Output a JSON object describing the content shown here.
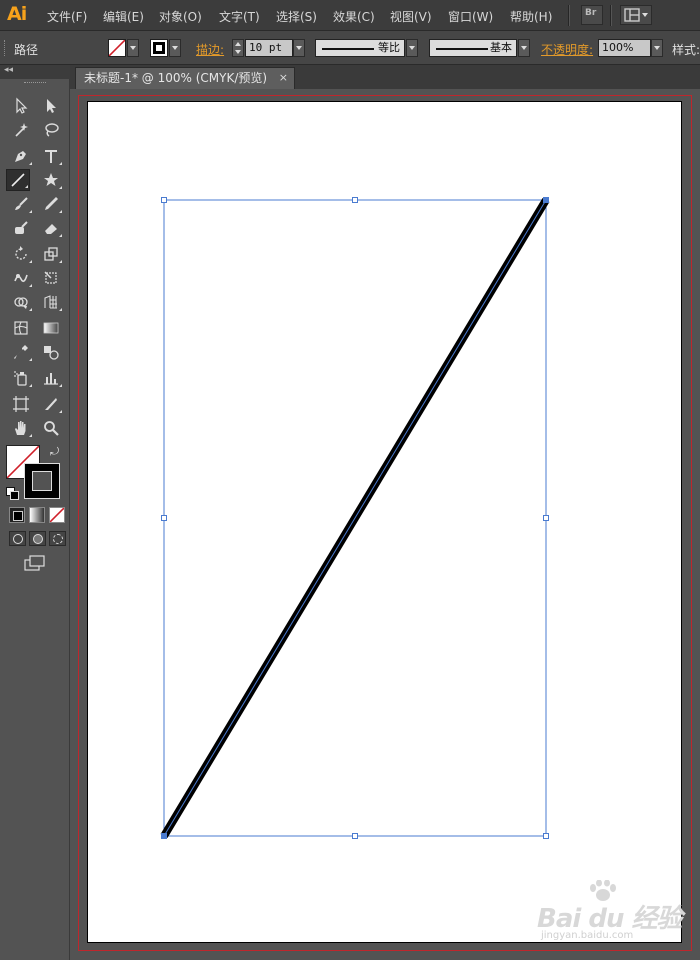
{
  "app": {
    "logo": "Ai"
  },
  "menu": {
    "items": [
      "文件(F)",
      "编辑(E)",
      "对象(O)",
      "文字(T)",
      "选择(S)",
      "效果(C)",
      "视图(V)",
      "窗口(W)",
      "帮助(H)"
    ],
    "bridge_label": "Br"
  },
  "control": {
    "path_label": "路径",
    "stroke_label": "描边:",
    "stroke_weight": "10 pt",
    "profile_label": "等比",
    "brush_label": "基本",
    "opacity_label": "不透明度:",
    "opacity_value": "100%",
    "style_label": "样式:"
  },
  "document": {
    "tab_title": "未标题-1* @ 100% (CMYK/预览)",
    "close_glyph": "×"
  },
  "toolbox": {
    "collapse_glyph": "◂◂",
    "tools": [
      "selection-tool",
      "direct-selection-tool",
      "magic-wand-tool",
      "lasso-tool",
      "pen-tool",
      "type-tool",
      "line-segment-tool",
      "star-tool",
      "paintbrush-tool",
      "pencil-tool",
      "blob-brush-tool",
      "eraser-tool",
      "rotate-tool",
      "scale-tool",
      "warp-tool",
      "free-transform-tool",
      "shape-builder-tool",
      "perspective-grid-tool",
      "mesh-tool",
      "gradient-tool",
      "eyedropper-tool",
      "blend-tool",
      "symbol-sprayer-tool",
      "column-graph-tool",
      "artboard-tool",
      "slice-tool",
      "hand-tool",
      "zoom-tool"
    ],
    "active_tool": "line-segment-tool"
  },
  "colors": {
    "accent": "#f7a21b",
    "selection": "#4a7bd0",
    "bleed": "#c0262c",
    "stroke": "#000000"
  },
  "watermark": {
    "main": "Bai du 经验",
    "sub": "jingyan.baidu.com"
  }
}
